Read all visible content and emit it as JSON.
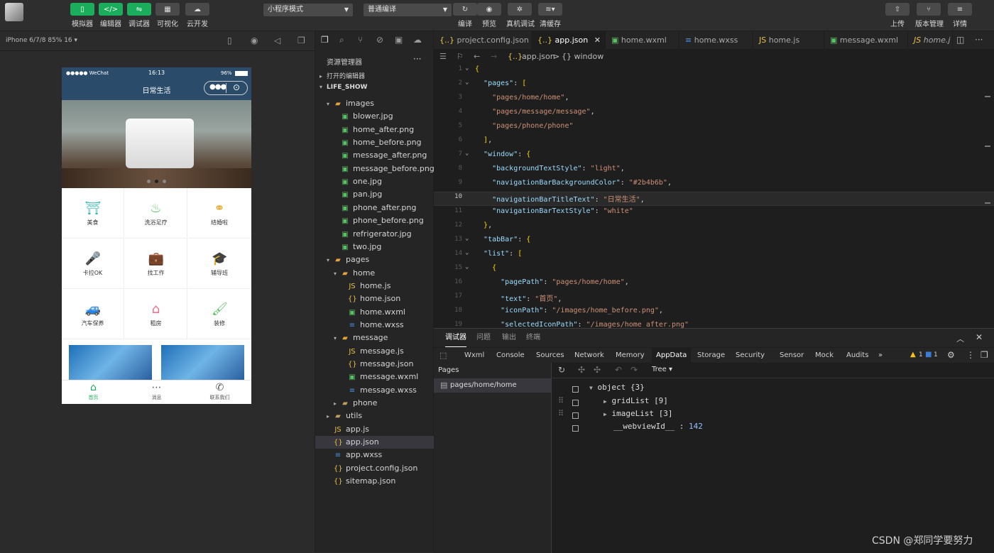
{
  "toolbar": {
    "left_buttons": [
      {
        "label": "模拟器",
        "icon": "phone-icon"
      },
      {
        "label": "编辑器",
        "icon": "code-icon"
      },
      {
        "label": "调试器",
        "icon": "debug-icon"
      },
      {
        "label": "可视化",
        "icon": "layout-icon"
      },
      {
        "label": "云开发",
        "icon": "cloud-icon"
      }
    ],
    "mode_select": "小程序模式",
    "compile_select": "普通编译",
    "middle_buttons": [
      "编译",
      "预览",
      "真机调试",
      "清缓存"
    ],
    "right_buttons": [
      "上传",
      "版本管理",
      "详情"
    ]
  },
  "simulator": {
    "device": "iPhone 6/7/8 85% 16 ▾",
    "status_left": "●●●●● WeChat",
    "status_time": "16:13",
    "status_battery": "96%",
    "nav_title": "日常生活",
    "grid": [
      "美食",
      "洗浴足疗",
      "结婚啦",
      "卡拉OK",
      "找工作",
      "辅导班",
      "汽车保养",
      "租房",
      "装修"
    ],
    "tabs": [
      "首页",
      "消息",
      "联系我们"
    ]
  },
  "explorer": {
    "title": "资源管理器",
    "open_editors": "打开的编辑器",
    "project": "LIFE_SHOW",
    "tree": [
      {
        "name": "images",
        "depth": 1,
        "type": "folder-open"
      },
      {
        "name": "blower.jpg",
        "depth": 2,
        "type": "image"
      },
      {
        "name": "home_after.png",
        "depth": 2,
        "type": "image"
      },
      {
        "name": "home_before.png",
        "depth": 2,
        "type": "image"
      },
      {
        "name": "message_after.png",
        "depth": 2,
        "type": "image"
      },
      {
        "name": "message_before.png",
        "depth": 2,
        "type": "image"
      },
      {
        "name": "one.jpg",
        "depth": 2,
        "type": "image"
      },
      {
        "name": "pan.jpg",
        "depth": 2,
        "type": "image"
      },
      {
        "name": "phone_after.png",
        "depth": 2,
        "type": "image"
      },
      {
        "name": "phone_before.png",
        "depth": 2,
        "type": "image"
      },
      {
        "name": "refrigerator.jpg",
        "depth": 2,
        "type": "image"
      },
      {
        "name": "two.jpg",
        "depth": 2,
        "type": "image"
      },
      {
        "name": "pages",
        "depth": 1,
        "type": "folder-open"
      },
      {
        "name": "home",
        "depth": 2,
        "type": "folder-open"
      },
      {
        "name": "home.js",
        "depth": 3,
        "type": "js"
      },
      {
        "name": "home.json",
        "depth": 3,
        "type": "json"
      },
      {
        "name": "home.wxml",
        "depth": 3,
        "type": "wxml"
      },
      {
        "name": "home.wxss",
        "depth": 3,
        "type": "wxss"
      },
      {
        "name": "message",
        "depth": 2,
        "type": "folder-open"
      },
      {
        "name": "message.js",
        "depth": 3,
        "type": "js"
      },
      {
        "name": "message.json",
        "depth": 3,
        "type": "json"
      },
      {
        "name": "message.wxml",
        "depth": 3,
        "type": "wxml"
      },
      {
        "name": "message.wxss",
        "depth": 3,
        "type": "wxss"
      },
      {
        "name": "phone",
        "depth": 2,
        "type": "folder"
      },
      {
        "name": "utils",
        "depth": 1,
        "type": "folder"
      },
      {
        "name": "app.js",
        "depth": 1,
        "type": "js"
      },
      {
        "name": "app.json",
        "depth": 1,
        "type": "json",
        "active": true
      },
      {
        "name": "app.wxss",
        "depth": 1,
        "type": "wxss"
      },
      {
        "name": "project.config.json",
        "depth": 1,
        "type": "json"
      },
      {
        "name": "sitemap.json",
        "depth": 1,
        "type": "json"
      }
    ]
  },
  "editor": {
    "tabs": [
      {
        "name": "project.config.json",
        "icon": "{..}"
      },
      {
        "name": "app.json",
        "icon": "{..}",
        "active": true
      },
      {
        "name": "home.wxml",
        "icon": "wxml"
      },
      {
        "name": "home.wxss",
        "icon": "wxss"
      },
      {
        "name": "home.js",
        "icon": "js"
      },
      {
        "name": "message.wxml",
        "icon": "wxml"
      },
      {
        "name": "home.j",
        "icon": "js"
      }
    ],
    "breadcrumb_file": "app.json",
    "breadcrumb_sep": ">",
    "breadcrumb_node": "{} window",
    "lines": [
      "{",
      "  \"pages\": [",
      "    \"pages/home/home\",",
      "    \"pages/message/message\",",
      "    \"pages/phone/phone\"",
      "  ],",
      "  \"window\": {",
      "    \"backgroundTextStyle\": \"light\",",
      "    \"navigationBarBackgroundColor\": \"#2b4b6b\",",
      "    \"navigationBarTitleText\": \"日常生活\",",
      "    \"navigationBarTextStyle\": \"white\"",
      "  },",
      "  \"tabBar\": {",
      "  \"list\": [",
      "    {",
      "      \"pagePath\": \"pages/home/home\",",
      "      \"text\": \"首页\",",
      "      \"iconPath\": \"/images/home_before.png\",",
      "      \"selectedIconPath\": \"/images/home_after.png\""
    ],
    "line_numbers": [
      "1",
      "2",
      "3",
      "4",
      "5",
      "6",
      "7",
      "8",
      "9",
      "10",
      "11",
      "12",
      "13",
      "14",
      "15",
      "16",
      "17",
      "18",
      "19"
    ],
    "current_line": 10
  },
  "panel": {
    "title_tabs": [
      "调试器",
      "问题",
      "输出",
      "终端"
    ],
    "dev_tabs": [
      "Wxml",
      "Console",
      "Sources",
      "Network",
      "Memory",
      "AppData",
      "Storage",
      "Security",
      "Sensor",
      "Mock",
      "Audits"
    ],
    "warnings": "1",
    "infos": "1",
    "pages_title": "Pages",
    "pages_item": "pages/home/home",
    "view_mode": "Tree",
    "tree": [
      {
        "key": "object",
        "val": "{3}"
      },
      {
        "key": "gridList",
        "val": "[9]"
      },
      {
        "key": "imageList",
        "val": "[3]"
      },
      {
        "key": "__webviewId__",
        "val": "142"
      }
    ]
  },
  "watermark": "CSDN @郑同学要努力",
  "colors": {
    "nav": "#2b4b6b",
    "green": "#1aad5b"
  }
}
